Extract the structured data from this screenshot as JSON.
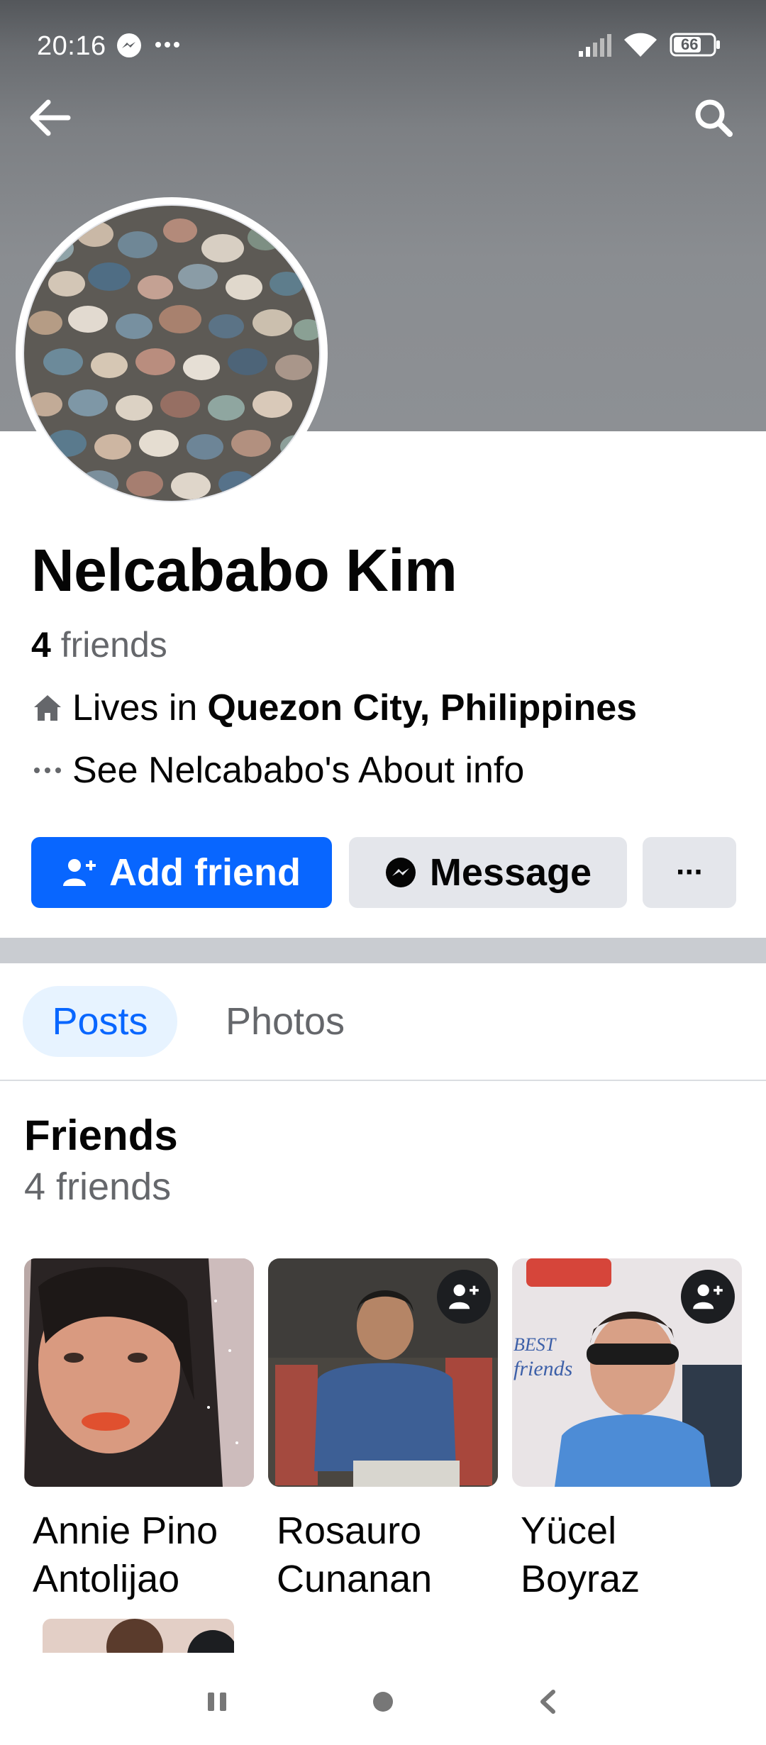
{
  "status_bar": {
    "time": "20:16",
    "battery": "66"
  },
  "header": {
    "back_icon": "arrow-left-icon",
    "search_icon": "search-icon"
  },
  "profile": {
    "name": "Nelcababo Kim",
    "friends_number": "4",
    "friends_word": "friends",
    "lives_prefix": "Lives in",
    "lives_place": "Quezon City, Philippines",
    "about_text": "See Nelcababo's About info"
  },
  "actions": {
    "add_friend": "Add friend",
    "message": "Message",
    "more": "···"
  },
  "tabs": [
    {
      "label": "Posts",
      "active": true
    },
    {
      "label": "Photos",
      "active": false
    }
  ],
  "friends_section": {
    "title": "Friends",
    "count": "4 friends",
    "items": [
      {
        "first": "Annie Pino",
        "last": "Antolijao"
      },
      {
        "first": "Rosauro",
        "last": "Cunanan"
      },
      {
        "first": "Yücel",
        "last": "Boyraz"
      }
    ]
  },
  "colors": {
    "accent": "#0866ff",
    "secondary_button": "#e4e6eb",
    "text_primary": "#050505",
    "text_secondary": "#65676b"
  }
}
